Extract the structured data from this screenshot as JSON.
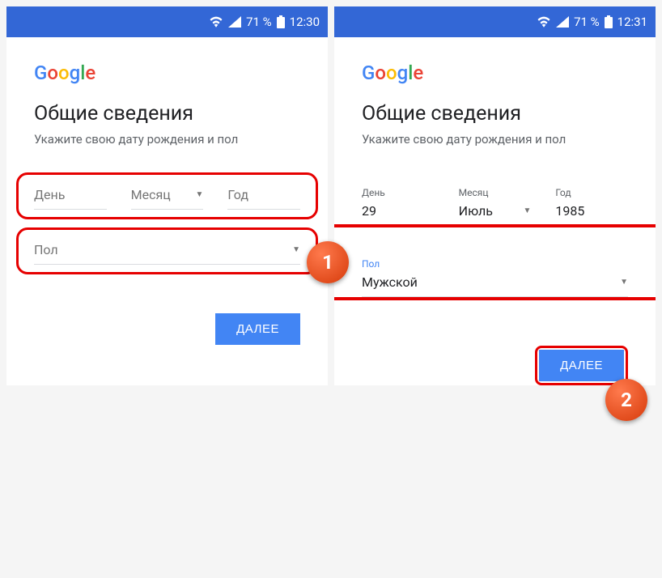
{
  "left": {
    "status": {
      "battery": "71 %",
      "time": "12:30"
    },
    "heading": "Общие сведения",
    "subtitle": "Укажите свою дату рождения и пол",
    "day_placeholder": "День",
    "month_placeholder": "Месяц",
    "year_placeholder": "Год",
    "gender_placeholder": "Пол",
    "next_label": "ДАЛЕЕ",
    "marker": "1"
  },
  "right": {
    "status": {
      "battery": "71 %",
      "time": "12:31"
    },
    "heading": "Общие сведения",
    "subtitle": "Укажите свою дату рождения и пол",
    "day_label": "День",
    "month_label": "Месяц",
    "year_label": "Год",
    "day_value": "29",
    "month_value": "Июль",
    "year_value": "1985",
    "gender_label": "Пол",
    "gender_value": "Мужской",
    "next_label": "ДАЛЕЕ",
    "marker": "2"
  },
  "logo": {
    "g1": "G",
    "o1": "o",
    "o2": "o",
    "g2": "g",
    "l": "l",
    "e": "e"
  }
}
